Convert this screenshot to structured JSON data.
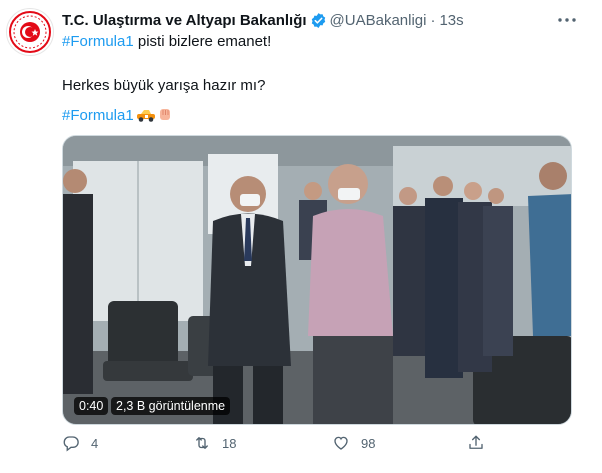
{
  "tweet": {
    "display_name": "T.C. Ulaştırma ve Altyapı Bakanlığı",
    "handle": "@UABakanligi",
    "separator": "·",
    "time": "13s",
    "line1_hashtag": "#Formula1",
    "line1_text": " pisti bizlere emanet!",
    "line2_text": "Herkes büyük yarışa hazır mı?",
    "line3_hashtag": "#Formula1",
    "emoji_names": [
      "race-car-emoji",
      "fist-bump-emoji"
    ],
    "link_color": "#1d9bf0",
    "muted_color": "#536471",
    "video": {
      "duration": "0:40",
      "views": "2,3 B görüntülenme"
    },
    "actions": {
      "reply_count": "4",
      "retweet_count": "18",
      "like_count": "98"
    }
  }
}
